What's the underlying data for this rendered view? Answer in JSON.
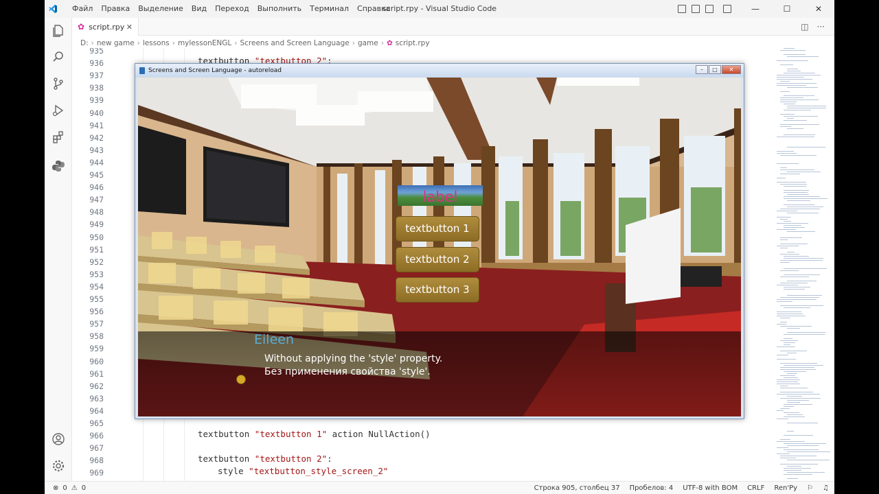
{
  "window": {
    "title": "script.rpy - Visual Studio Code",
    "menu": [
      "Файл",
      "Правка",
      "Выделение",
      "Вид",
      "Переход",
      "Выполнить",
      "Терминал",
      "Справка"
    ],
    "controls": {
      "minimize": "—",
      "maximize": "☐",
      "close": "✕"
    }
  },
  "activity_bar": [
    "files-icon",
    "search-icon",
    "source-control-icon",
    "run-debug-icon",
    "extensions-icon",
    "python-icon",
    "account-icon",
    "settings-gear-icon"
  ],
  "tab": {
    "label": "script.rpy",
    "close": "✕"
  },
  "tab_actions": {
    "split": "◫",
    "more": "···"
  },
  "breadcrumb": [
    "D:",
    "new game",
    "lessons",
    "mylessonENGL",
    "Screens and Screen Language",
    "game",
    "script.rpy"
  ],
  "editor": {
    "line_numbers": [
      "935",
      "936",
      "937",
      "938",
      "939",
      "940",
      "941",
      "942",
      "943",
      "944",
      "945",
      "946",
      "947",
      "948",
      "949",
      "950",
      "951",
      "952",
      "953",
      "954",
      "955",
      "956",
      "957",
      "958",
      "959",
      "960",
      "961",
      "962",
      "963",
      "964",
      "965",
      "966",
      "967",
      "968",
      "969"
    ],
    "visible_code": [
      {
        "name": "textbutton",
        "arg": "\"textbutton 2\"",
        "rest": ":"
      },
      {
        "name": "textbutton",
        "arg": "\"textbutton 1\"",
        "rest": " action NullAction()"
      },
      {
        "name": "textbutton",
        "arg": "\"textbutton 2\"",
        "rest": ":"
      },
      {
        "name": "style",
        "arg": "\"textbutton_style_screen_2\"",
        "rest": ""
      }
    ]
  },
  "game_window": {
    "title": "Screens and Screen Language - autoreload",
    "label": "label",
    "buttons": [
      "textbutton 1",
      "textbutton 2",
      "textbutton 3"
    ],
    "speaker": "Eileen",
    "dialogue": [
      "Without applying the 'style' property.",
      "Без применения свойства 'style'."
    ]
  },
  "status_bar": {
    "errors": "0",
    "warnings": "0",
    "position": "Строка 905, столбец 37",
    "indent": "Пробелов: 4",
    "encoding": "UTF-8 with BOM",
    "eol": "CRLF",
    "language": "Ren'Py"
  },
  "colors": {
    "accent_blue": "#007acc",
    "label_pink": "#e02e8a",
    "speaker_blue": "#5aaed8",
    "button_gold": "#a0802f"
  }
}
